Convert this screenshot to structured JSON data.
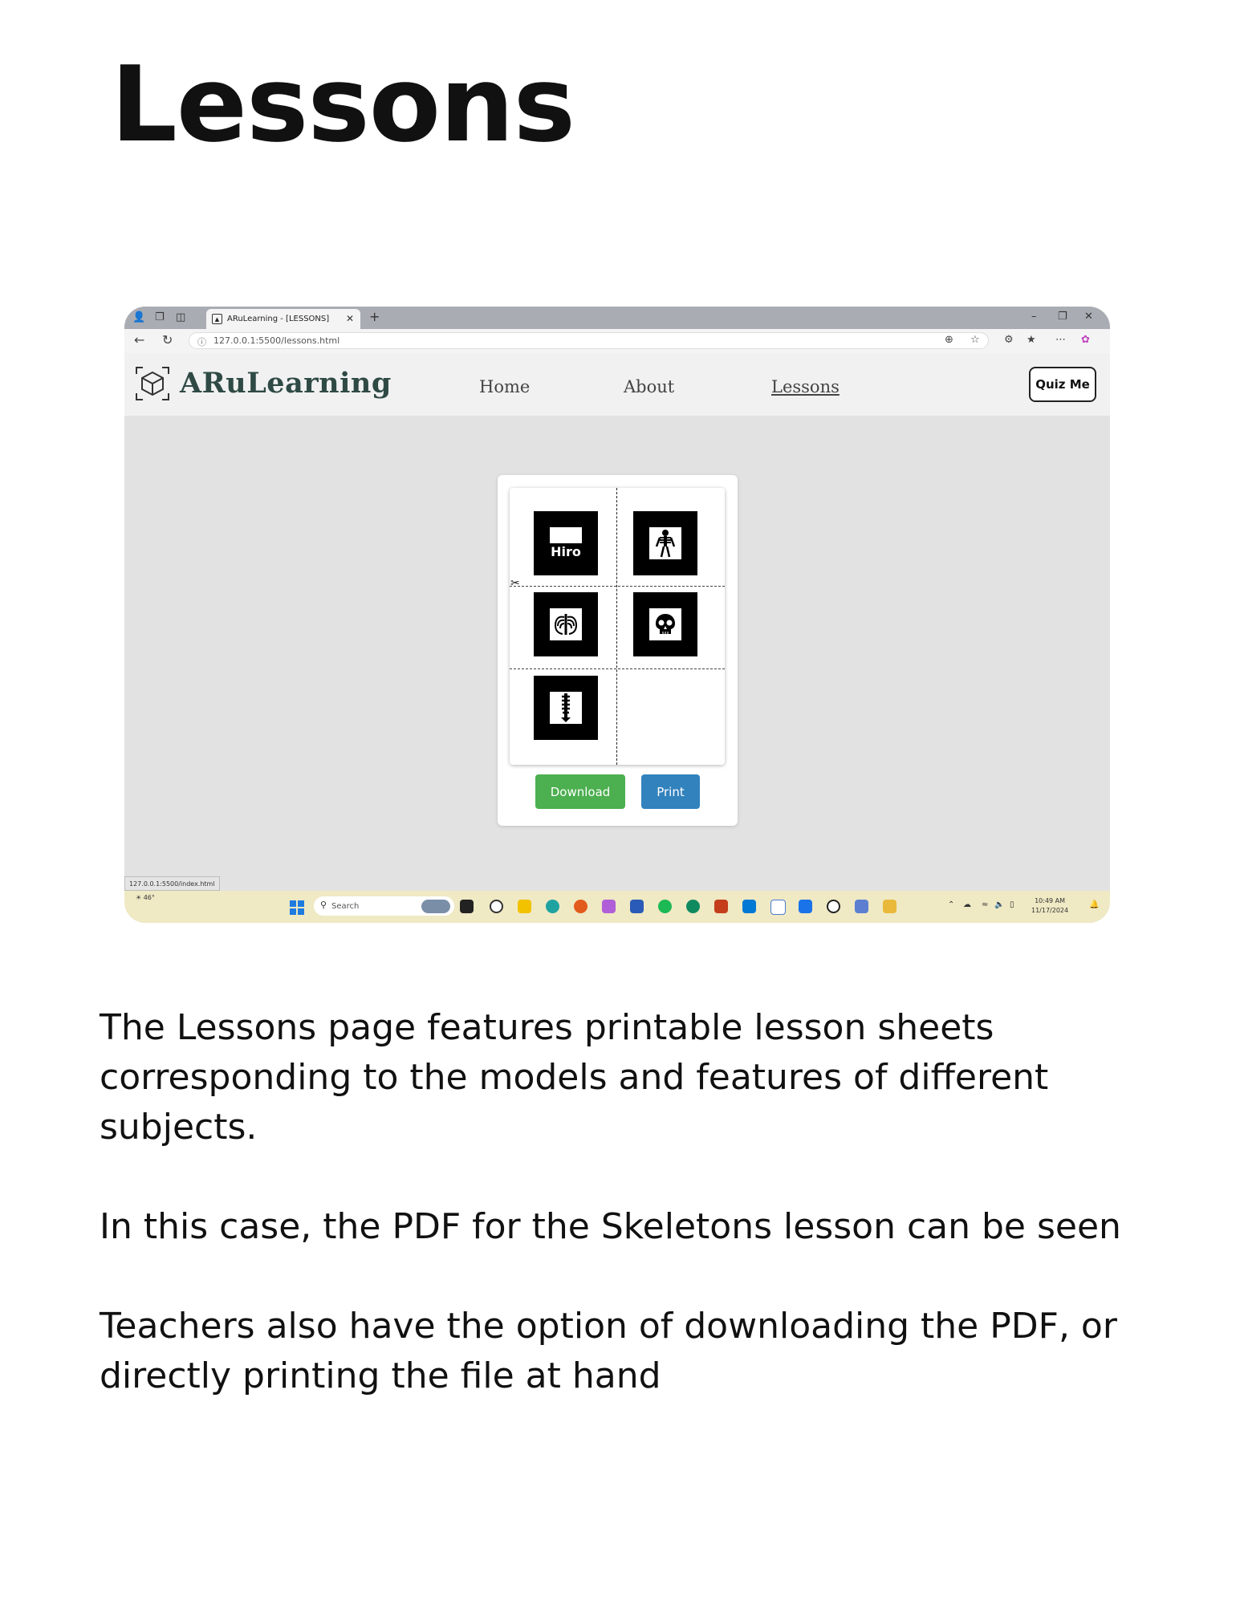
{
  "page": {
    "title": "Lessons",
    "paragraphs": [
      "The Lessons page features printable lesson sheets corresponding to the models and features of different subjects.",
      "In this case, the PDF for the Skeletons lesson can be seen",
      "Teachers also have the option of downloading the PDF, or directly printing the file at hand"
    ]
  },
  "browser": {
    "tab_title": "ARuLearning - [LESSONS]",
    "url": "127.0.0.1:5500/lessons.html",
    "status_link": "127.0.0.1:5500/index.html"
  },
  "site": {
    "brand": "ARuLearning",
    "nav": [
      "Home",
      "About",
      "Lessons"
    ],
    "active_nav": "Lessons",
    "quiz_button": "Quiz Me",
    "brand_color": "#2f4a45"
  },
  "lesson": {
    "markers": [
      "hiro-marker",
      "skeleton-marker",
      "ribcage-marker",
      "skull-marker",
      "spine-marker"
    ],
    "hiro_text": "Hiro",
    "download_label": "Download",
    "print_label": "Print",
    "download_color": "#4caf50",
    "print_color": "#3182bd"
  },
  "taskbar": {
    "weather": "46°",
    "search_placeholder": "Search",
    "time": "10:49 AM",
    "date": "11/17/2024"
  }
}
